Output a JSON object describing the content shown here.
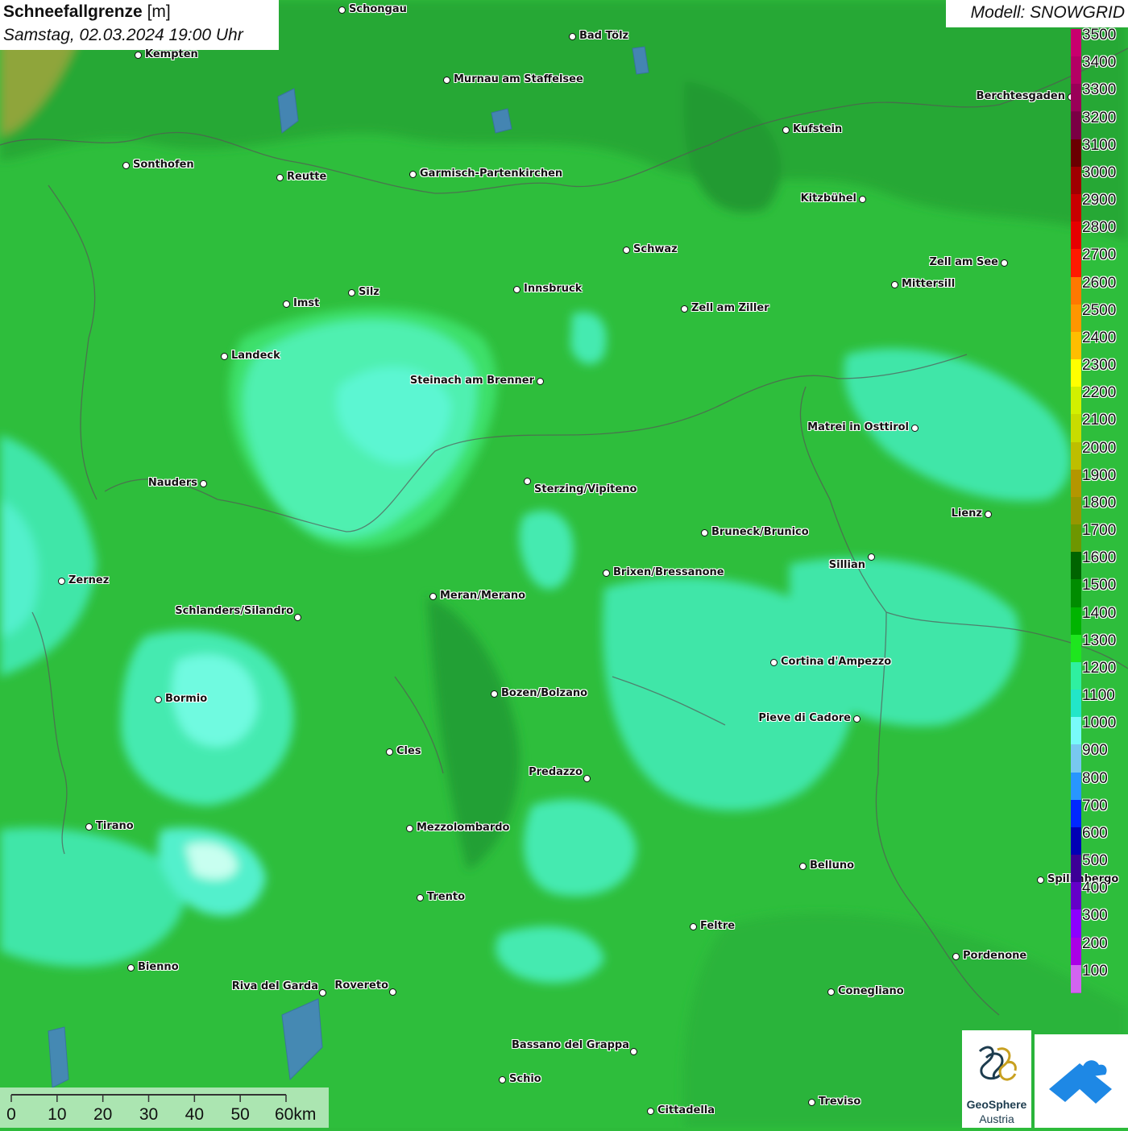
{
  "header": {
    "title_main": "Schneefallgrenze",
    "title_unit": "[m]",
    "subtitle": "Samstag, 02.03.2024 19:00 Uhr",
    "model": "Modell: SNOWGRID"
  },
  "cities": [
    {
      "name": "Schongau"
    },
    {
      "name": "Bad Tölz"
    },
    {
      "name": "Kempten"
    },
    {
      "name": "Murnau am Staffelsee"
    },
    {
      "name": "Berchtesgaden"
    },
    {
      "name": "Kufstein"
    },
    {
      "name": "Sonthofen"
    },
    {
      "name": "Reutte"
    },
    {
      "name": "Garmisch-Partenkirchen"
    },
    {
      "name": "Kitzbühel"
    },
    {
      "name": "Schwaz"
    },
    {
      "name": "Zell am See"
    },
    {
      "name": "Innsbruck"
    },
    {
      "name": "Mittersill"
    },
    {
      "name": "Silz"
    },
    {
      "name": "Imst"
    },
    {
      "name": "Zell am Ziller"
    },
    {
      "name": "Landeck"
    },
    {
      "name": "Steinach am Brenner"
    },
    {
      "name": "Matrei in Osttirol"
    },
    {
      "name": "Nauders"
    },
    {
      "name": "Sterzing/Vipiteno"
    },
    {
      "name": "Lienz"
    },
    {
      "name": "Bruneck/Brunico"
    },
    {
      "name": "Sillian"
    },
    {
      "name": "Brixen/Bressanone"
    },
    {
      "name": "Zernez"
    },
    {
      "name": "Meran/Merano"
    },
    {
      "name": "Schlanders/Silandro"
    },
    {
      "name": "Cortina d'Ampezzo"
    },
    {
      "name": "Bozen/Bolzano"
    },
    {
      "name": "Bormio"
    },
    {
      "name": "Pieve di Cadore"
    },
    {
      "name": "Cles"
    },
    {
      "name": "Predazzo"
    },
    {
      "name": "Tirano"
    },
    {
      "name": "Mezzolombardo"
    },
    {
      "name": "Belluno"
    },
    {
      "name": "Spilimbergo"
    },
    {
      "name": "Trento"
    },
    {
      "name": "Feltre"
    },
    {
      "name": "Pordenone"
    },
    {
      "name": "Bienno"
    },
    {
      "name": "Riva del Garda"
    },
    {
      "name": "Rovereto"
    },
    {
      "name": "Conegliano"
    },
    {
      "name": "Bassano del Grappa"
    },
    {
      "name": "Schio"
    },
    {
      "name": "Treviso"
    },
    {
      "name": "Cittadella"
    }
  ],
  "legend": {
    "levels": [
      {
        "label": "3500",
        "color": "#c8006e"
      },
      {
        "label": "3400",
        "color": "#b40064"
      },
      {
        "label": "3300",
        "color": "#9a0058"
      },
      {
        "label": "3200",
        "color": "#7a0044"
      },
      {
        "label": "3100",
        "color": "#6a0000"
      },
      {
        "label": "3000",
        "color": "#a00000"
      },
      {
        "label": "2900",
        "color": "#c80000"
      },
      {
        "label": "2800",
        "color": "#e60000"
      },
      {
        "label": "2700",
        "color": "#ff1a00"
      },
      {
        "label": "2600",
        "color": "#ff7800"
      },
      {
        "label": "2500",
        "color": "#ff9600"
      },
      {
        "label": "2400",
        "color": "#ffbe00"
      },
      {
        "label": "2300",
        "color": "#ffff00"
      },
      {
        "label": "2200",
        "color": "#d2f000"
      },
      {
        "label": "2100",
        "color": "#c8dc00"
      },
      {
        "label": "2000",
        "color": "#bebe00"
      },
      {
        "label": "1900",
        "color": "#b49600"
      },
      {
        "label": "1800",
        "color": "#969600"
      },
      {
        "label": "1700",
        "color": "#6e9600"
      },
      {
        "label": "1600",
        "color": "#006400"
      },
      {
        "label": "1500",
        "color": "#008c00"
      },
      {
        "label": "1400",
        "color": "#00b400"
      },
      {
        "label": "1300",
        "color": "#1ee61e"
      },
      {
        "label": "1200",
        "color": "#2ff0a0"
      },
      {
        "label": "1100",
        "color": "#22e6c8"
      },
      {
        "label": "1000",
        "color": "#78fafa"
      },
      {
        "label": "900",
        "color": "#78c8f0"
      },
      {
        "label": "800",
        "color": "#2896ff"
      },
      {
        "label": "700",
        "color": "#0028ff"
      },
      {
        "label": "600",
        "color": "#0000b4"
      },
      {
        "label": "500",
        "color": "#3c0096"
      },
      {
        "label": "400",
        "color": "#6400c8"
      },
      {
        "label": "300",
        "color": "#8c00ff"
      },
      {
        "label": "200",
        "color": "#aa00e6"
      },
      {
        "label": "100",
        "color": "#d264f0"
      }
    ]
  },
  "scale_bar": {
    "labels": [
      "0",
      "10",
      "20",
      "30",
      "40",
      "50",
      "60km"
    ]
  },
  "logo": {
    "name": "GeoSphere",
    "sub": "Austria"
  }
}
